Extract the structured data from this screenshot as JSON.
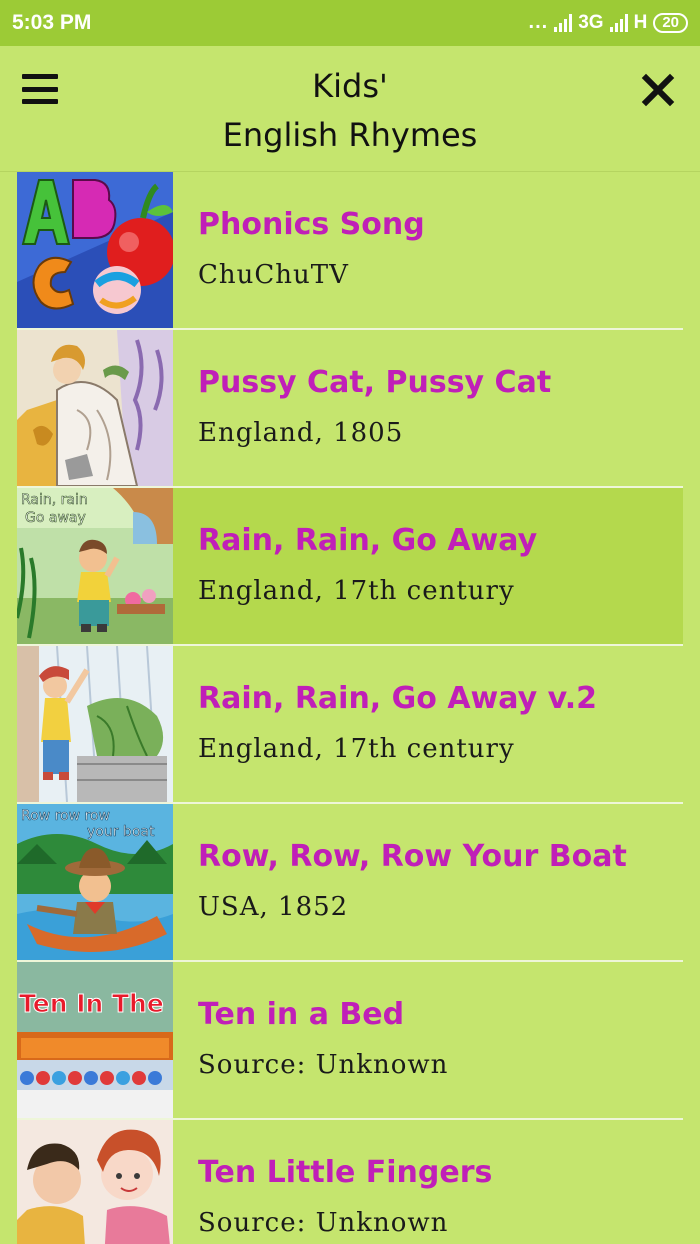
{
  "status_bar": {
    "time": "5:03 PM",
    "dots": "...",
    "network": "3G",
    "network2": "H",
    "battery": "20"
  },
  "header": {
    "title_line1": "Kids'",
    "title_line2": "English Rhymes",
    "menu_icon": "hamburger-menu-icon",
    "close_icon": "close-icon"
  },
  "rhymes": [
    {
      "title": "Phonics Song",
      "subtitle": "ChuChuTV",
      "thumb_text": ""
    },
    {
      "title": "Pussy Cat, Pussy Cat",
      "subtitle": "England, 1805",
      "thumb_text": ""
    },
    {
      "title": "Rain, Rain, Go Away",
      "subtitle": "England, 17th century",
      "thumb_text": "Rain, rain Go away"
    },
    {
      "title": "Rain, Rain, Go Away v.2",
      "subtitle": "England, 17th century",
      "thumb_text": ""
    },
    {
      "title": "Row, Row, Row Your Boat",
      "subtitle": "USA, 1852",
      "thumb_text": "Row row row your boat"
    },
    {
      "title": "Ten in a Bed",
      "subtitle": "Source: Unknown",
      "thumb_text": "Ten In The Bed"
    },
    {
      "title": "Ten Little Fingers",
      "subtitle": "Source: Unknown",
      "thumb_text": ""
    }
  ],
  "colors": {
    "status_bar": "#9ccb36",
    "background": "#c5e56e",
    "selected_row": "#b4d94d",
    "title_text": "#c01fb8"
  }
}
